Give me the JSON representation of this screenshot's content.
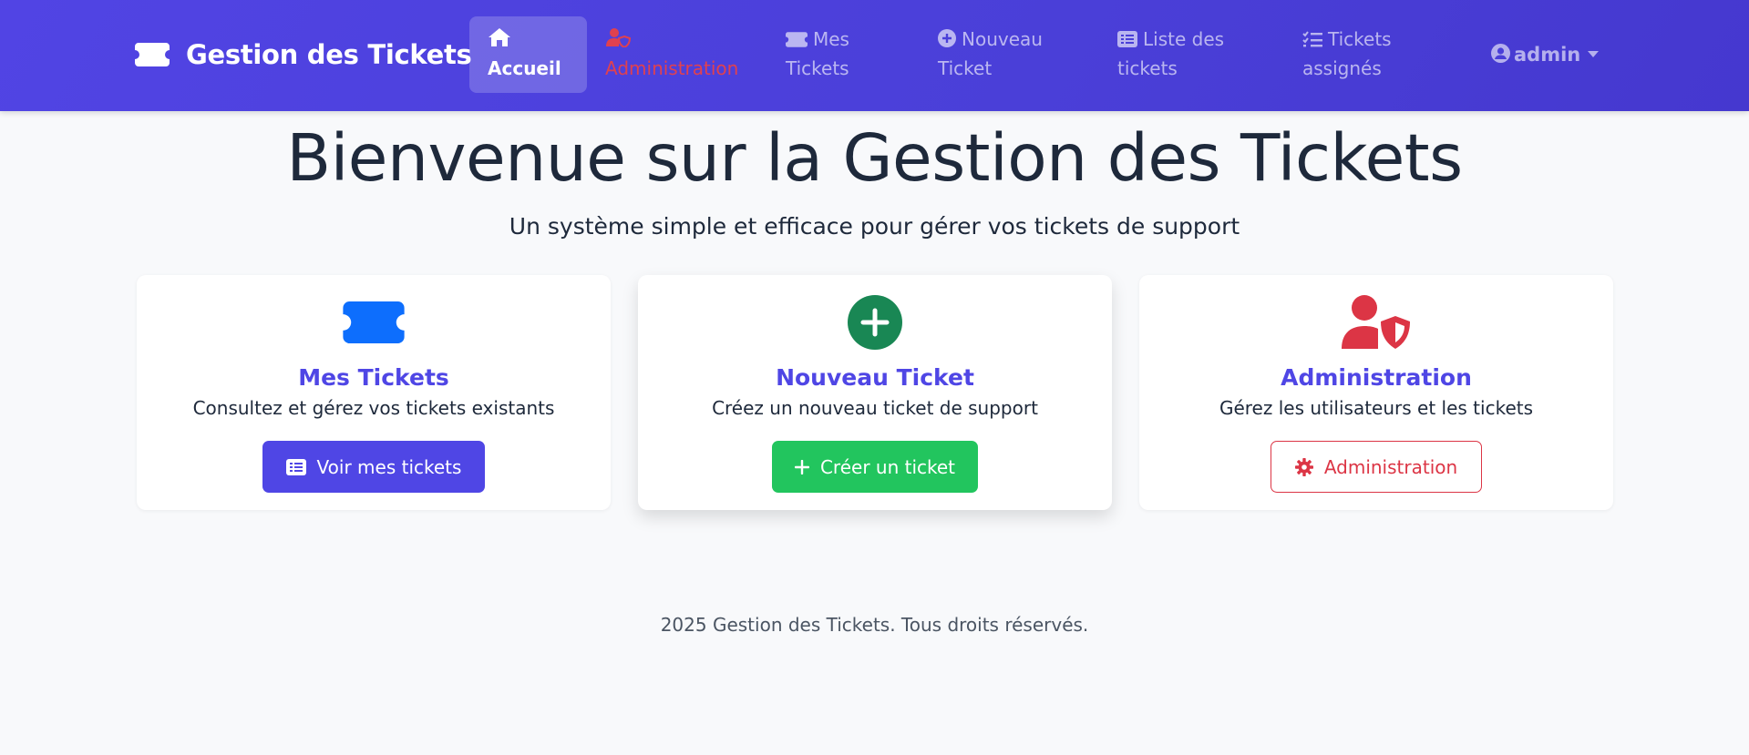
{
  "navbar": {
    "brand": "Gestion des Tickets",
    "items": [
      {
        "label": "Accueil",
        "icon": "home-icon"
      },
      {
        "label": "Administration",
        "icon": "user-shield-icon"
      },
      {
        "label_line1": "Mes",
        "label_line2": "Tickets",
        "icon": "ticket-icon"
      },
      {
        "label_line1": "Nouveau",
        "label_line2": "Ticket",
        "icon": "plus-circle-icon"
      },
      {
        "label_line1": "Liste des",
        "label_line2": "tickets",
        "icon": "list-icon"
      },
      {
        "label_line1": "Tickets",
        "label_line2": "assignés",
        "icon": "tasks-icon"
      }
    ],
    "user": "admin"
  },
  "hero": {
    "title": "Bienvenue sur la Gestion des Tickets",
    "subtitle": "Un système simple et efficace pour gérer vos tickets de support"
  },
  "cards": [
    {
      "title": "Mes Tickets",
      "text": "Consultez et gérez vos tickets existants",
      "button": "Voir mes tickets",
      "icon": "ticket-icon"
    },
    {
      "title": "Nouveau Ticket",
      "text": "Créez un nouveau ticket de support",
      "button": "Créer un ticket",
      "icon": "plus-circle-icon"
    },
    {
      "title": "Administration",
      "text": "Gérez les utilisateurs et les tickets",
      "button": "Administration",
      "icon": "user-shield-icon"
    }
  ],
  "footer": "2025 Gestion des Tickets. Tous droits réservés.",
  "colors": {
    "navbar": "#4f46e5",
    "primary": "#4f46e5",
    "success": "#22c55e",
    "danger": "#dc3545",
    "ticket_blue": "#0d6efd",
    "plus_green": "#198754"
  }
}
